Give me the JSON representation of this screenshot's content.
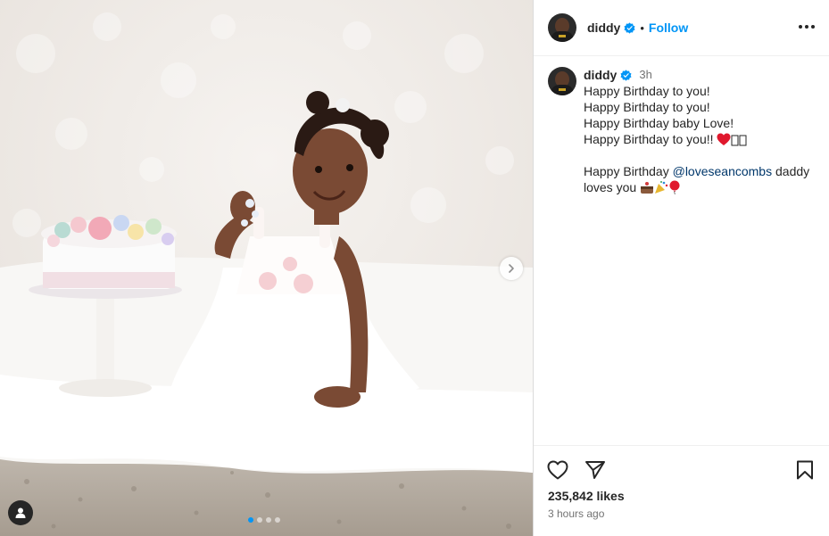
{
  "post": {
    "username": "diddy",
    "follow_label": "Follow",
    "separator": "•",
    "caption_time": "3h",
    "caption_lines": [
      "Happy Birthday to you!",
      "Happy Birthday to you!",
      "Happy Birthday baby Love!",
      "Happy Birthday to you!!"
    ],
    "closing_prefix": "Happy Birthday ",
    "mention": "@loveseancombs",
    "closing_suffix_1": " daddy",
    "closing_suffix_2": "loves you ",
    "likes": "235,842 likes",
    "posted_ago": "3 hours ago"
  },
  "media": {
    "slide_count": 4,
    "active_slide": 1,
    "icons": [
      "chevron-right-icon",
      "user-tag-icon"
    ]
  },
  "icons": {
    "verified": "verified-badge-icon",
    "more": "more-options-icon",
    "like": "heart-icon",
    "share": "paper-plane-icon",
    "save": "bookmark-icon"
  },
  "colors": {
    "accent": "#0095f6",
    "verified": "#0095f6",
    "text": "#262626",
    "muted": "#737373",
    "mention": "#00376b"
  }
}
